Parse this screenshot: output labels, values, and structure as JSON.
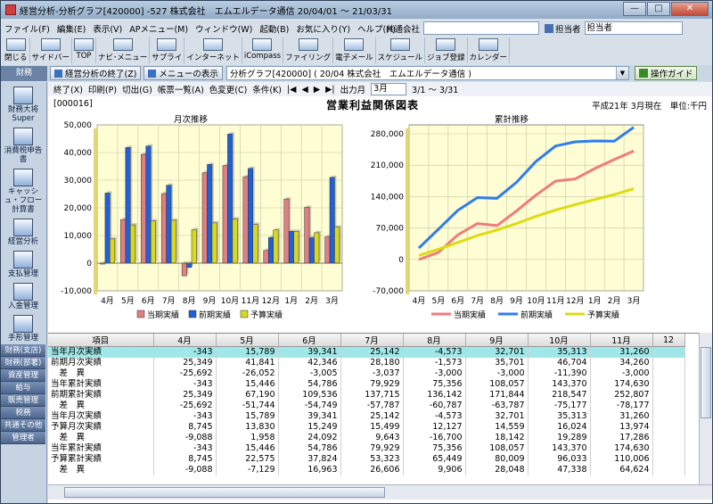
{
  "window": {
    "title": "経営分析-分析グラフ[420000] -527 株式会社　エムエルデータ通信 20/04/01 ～ 21/03/31",
    "btn_min": "—",
    "btn_max": "□",
    "btn_close": "✕"
  },
  "menu": [
    "ファイル(F)",
    "編集(E)",
    "表示(V)",
    "APメニュー(M)",
    "ウィンドウ(W)",
    "起動(B)",
    "お気に入り(Y)",
    "ヘルプ(H)"
  ],
  "user": {
    "company_label": "共通会社",
    "company_value": "",
    "person_label": "担当者",
    "person_value": "担当者"
  },
  "toolbar": [
    "閉じる",
    "サイドバー",
    "TOP",
    "ナビ･メニュー",
    "サプライ",
    "インターネット",
    "iCompass",
    "ファイリング",
    "電子メール",
    "スケジュール",
    "ジョブ登録",
    "カレンダー"
  ],
  "row3": {
    "dept_tab": "財務",
    "end_btn": "経営分析の終了(Z)",
    "menu_btn": "メニューの表示",
    "combo_value": "分析グラフ[420000] ( 20/04 株式会社　エムエルデータ通信 )",
    "guide_btn": "操作ガイド"
  },
  "sidebar": {
    "items": [
      {
        "label": "財務大将 Super"
      },
      {
        "label": "消費税申告書"
      },
      {
        "label": "キャッシュ・フロー計算書"
      },
      {
        "label": "経営分析"
      },
      {
        "label": "支払管理"
      },
      {
        "label": "入金管理"
      },
      {
        "label": "手形管理"
      }
    ],
    "tabs": [
      "財務(支店)",
      "財務(部署)",
      "資産管理",
      "給与",
      "販売管理",
      "税務",
      "共通その他",
      "管理者"
    ]
  },
  "report_toolbar": {
    "end": "終了(X)",
    "print": "印刷(P)",
    "cut": "切出(G)",
    "list": "帳票一覧(A)",
    "color": "色変更(C)",
    "cond": "条件(K)",
    "first": "|◀",
    "prev": "◀",
    "next": "▶",
    "last": "▶|",
    "output_month_label": "出力月",
    "output_month_value": "3月",
    "range": "3/1 ～ 3/31"
  },
  "report": {
    "code": "[000016]",
    "title": "営業利益関係図表",
    "info": "平成21年 3月現在　単位:千円"
  },
  "colors": {
    "actual": "#e08080",
    "prev": "#2060d8",
    "budget": "#d8d820",
    "actual_line": "#f07c7c",
    "prev_line": "#2f7cf0",
    "budget_line": "#dcdc10",
    "highlight_row": "#9fe7e8"
  },
  "chart_data": [
    {
      "type": "bar",
      "title": "月次推移",
      "categories": [
        "4月",
        "5月",
        "6月",
        "7月",
        "8月",
        "9月",
        "10月",
        "11月",
        "12月",
        "1月",
        "2月",
        "3月"
      ],
      "series": [
        {
          "name": "当期実績",
          "values": [
            -343,
            15789,
            39341,
            25142,
            -4573,
            32701,
            35313,
            31260,
            4600,
            23200,
            20200,
            9500
          ]
        },
        {
          "name": "前期実績",
          "values": [
            25349,
            41841,
            42346,
            28180,
            -1573,
            35701,
            46704,
            34260,
            9300,
            11500,
            9200,
            31000
          ]
        },
        {
          "name": "予算実績",
          "values": [
            8745,
            13830,
            15249,
            15499,
            12127,
            14559,
            16024,
            13974,
            12000,
            11500,
            11000,
            13000
          ]
        }
      ],
      "ylim": [
        -10000,
        50000
      ],
      "yticks": [
        "-10,000",
        "0",
        "10,000",
        "20,000",
        "30,000",
        "40,000",
        "50,000"
      ],
      "legend": "bottom"
    },
    {
      "type": "line",
      "title": "累計推移",
      "categories": [
        "4月",
        "5月",
        "6月",
        "7月",
        "8月",
        "9月",
        "10月",
        "11月",
        "12月",
        "1月",
        "2月",
        "3月"
      ],
      "series": [
        {
          "name": "当期実績",
          "values": [
            -343,
            15446,
            54786,
            79929,
            75356,
            108057,
            143370,
            174630,
            179230,
            202430,
            222630,
            241700
          ]
        },
        {
          "name": "前期実績",
          "values": [
            25349,
            67190,
            109536,
            137715,
            136142,
            171844,
            218547,
            252807,
            262100,
            264000,
            263500,
            294500
          ]
        },
        {
          "name": "予算実績",
          "values": [
            8745,
            22575,
            37824,
            53323,
            65449,
            80009,
            96033,
            110006,
            122000,
            133500,
            144500,
            157500
          ]
        }
      ],
      "ylim": [
        -70000,
        280000
      ],
      "yticks": [
        "-70,000",
        "0",
        "70,000",
        "140,000",
        "210,000",
        "280,000"
      ],
      "legend": "bottom"
    }
  ],
  "table": {
    "headers": [
      "項目",
      "4月",
      "5月",
      "6月",
      "7月",
      "8月",
      "9月",
      "10月",
      "11月",
      "12"
    ],
    "rows": [
      {
        "label": "当年月次実績",
        "cells": [
          "-343",
          "15,789",
          "39,341",
          "25,142",
          "-4,573",
          "32,701",
          "35,313",
          "31,260",
          ""
        ],
        "hl": true
      },
      {
        "label": "前期月次実績",
        "cells": [
          "25,349",
          "41,841",
          "42,346",
          "28,180",
          "-1,573",
          "35,701",
          "46,704",
          "34,260",
          ""
        ]
      },
      {
        "label": "　差　異",
        "cells": [
          "-25,692",
          "-26,052",
          "-3,005",
          "-3,037",
          "-3,000",
          "-3,000",
          "-11,390",
          "-3,000",
          ""
        ]
      },
      {
        "label": "当年累計実績",
        "cells": [
          "-343",
          "15,446",
          "54,786",
          "79,929",
          "75,356",
          "108,057",
          "143,370",
          "174,630",
          ""
        ]
      },
      {
        "label": "前期累計実績",
        "cells": [
          "25,349",
          "67,190",
          "109,536",
          "137,715",
          "136,142",
          "171,844",
          "218,547",
          "252,807",
          ""
        ]
      },
      {
        "label": "　差　異",
        "cells": [
          "-25,692",
          "-51,744",
          "-54,749",
          "-57,787",
          "-60,787",
          "-63,787",
          "-75,177",
          "-78,177",
          ""
        ]
      },
      {
        "label": "当年月次実績",
        "cells": [
          "-343",
          "15,789",
          "39,341",
          "25,142",
          "-4,573",
          "32,701",
          "35,313",
          "31,260",
          ""
        ]
      },
      {
        "label": "予算月次実績",
        "cells": [
          "8,745",
          "13,830",
          "15,249",
          "15,499",
          "12,127",
          "14,559",
          "16,024",
          "13,974",
          ""
        ]
      },
      {
        "label": "　差　異",
        "cells": [
          "-9,088",
          "1,958",
          "24,092",
          "9,643",
          "-16,700",
          "18,142",
          "19,289",
          "17,286",
          ""
        ]
      },
      {
        "label": "当年累計実績",
        "cells": [
          "-343",
          "15,446",
          "54,786",
          "79,929",
          "75,356",
          "108,057",
          "143,370",
          "174,630",
          ""
        ]
      },
      {
        "label": "予算累計実績",
        "cells": [
          "8,745",
          "22,575",
          "37,824",
          "53,323",
          "65,449",
          "80,009",
          "96,033",
          "110,006",
          ""
        ]
      },
      {
        "label": "　差　異",
        "cells": [
          "-9,088",
          "-7,129",
          "16,963",
          "26,606",
          "9,906",
          "28,048",
          "47,338",
          "64,624",
          ""
        ]
      }
    ]
  }
}
